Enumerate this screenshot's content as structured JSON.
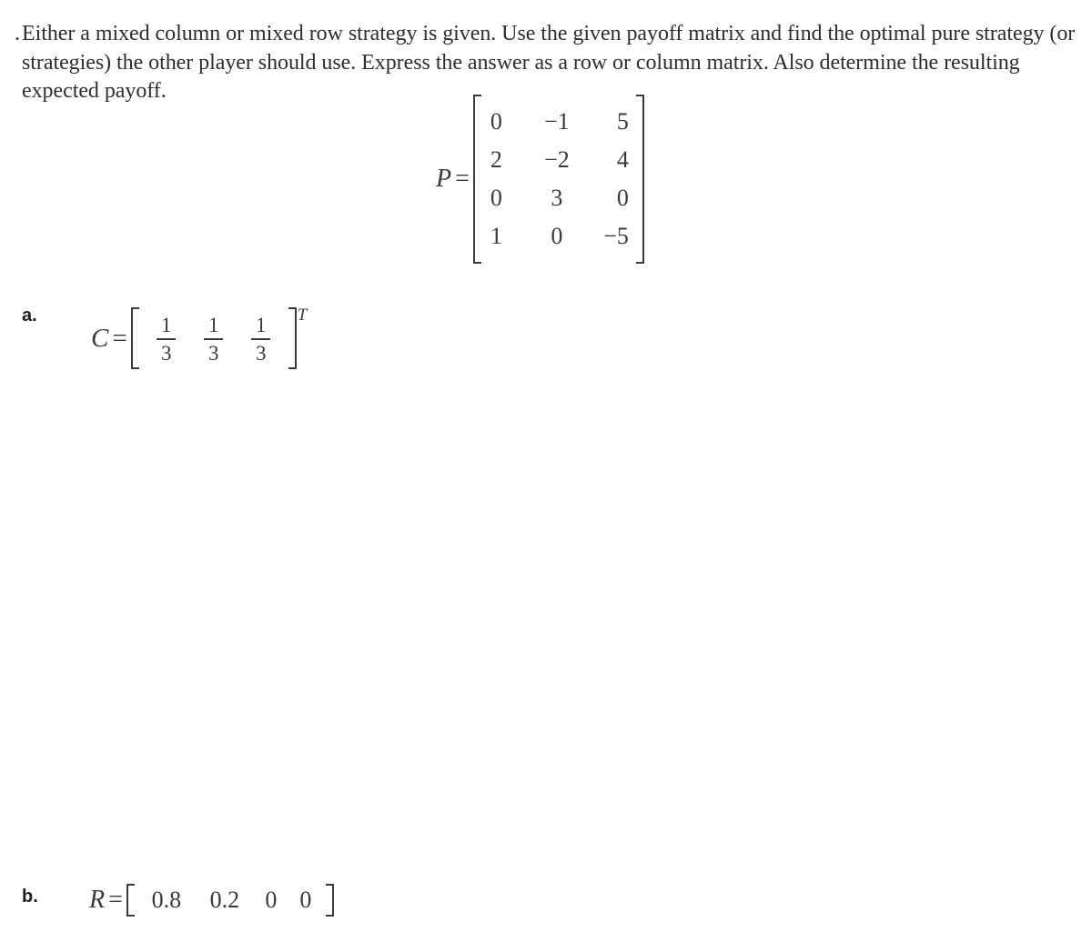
{
  "problem": {
    "number": ".",
    "statement": "Either a mixed column or mixed row strategy is given. Use the given payoff matrix and find the optimal pure strategy (or strategies) the other player should use. Express the answer as a row or column matrix. Also determine the resulting expected payoff."
  },
  "payoff_matrix": {
    "symbol": "P",
    "equals": "=",
    "rows": [
      [
        "0",
        "−1",
        "5"
      ],
      [
        "2",
        "−2",
        "4"
      ],
      [
        "0",
        "3",
        "0"
      ],
      [
        "1",
        "0",
        "−5"
      ]
    ]
  },
  "parts": [
    {
      "label": "a.",
      "symbol": "C",
      "equals": "=",
      "transpose": "T",
      "entries": [
        {
          "numerator": "1",
          "denominator": "3"
        },
        {
          "numerator": "1",
          "denominator": "3"
        },
        {
          "numerator": "1",
          "denominator": "3"
        }
      ]
    },
    {
      "label": "b.",
      "symbol": "R",
      "equals": "=",
      "entries": [
        "0.8",
        "0.2",
        "0",
        "0"
      ]
    }
  ]
}
